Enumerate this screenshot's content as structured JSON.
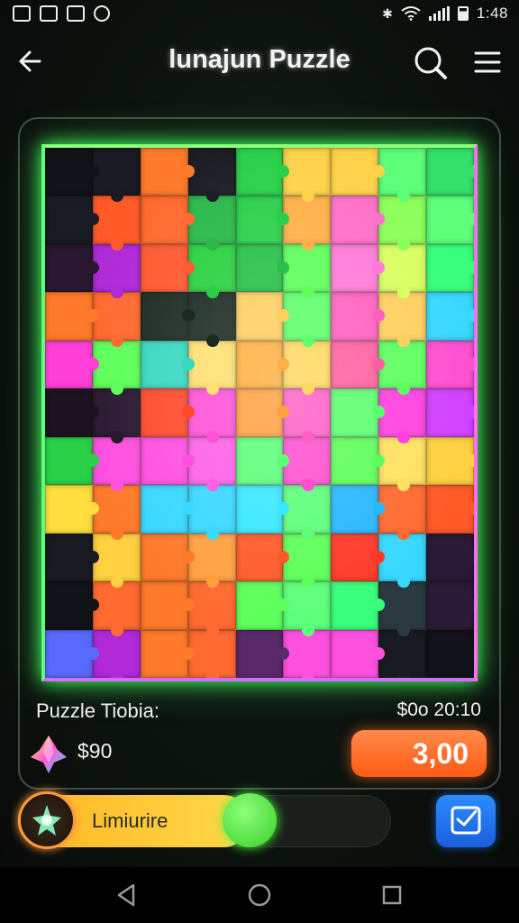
{
  "status_bar": {
    "time": "1:48",
    "left_icons": [
      "image-icon",
      "photo-icon",
      "gallery-icon",
      "shield-icon"
    ],
    "right_icons": [
      "bluetooth-icon",
      "wifi-icon",
      "signal-icon",
      "battery-icon"
    ]
  },
  "header": {
    "title": "lunajun Puzzle",
    "back_icon": "arrow-left-icon",
    "search_icon": "search-icon",
    "menu_icon": "hamburger-menu-icon"
  },
  "puzzle": {
    "grid_columns": 9,
    "grid_rows": 11,
    "frame_colors": [
      "#5dff7a",
      "#ff6cf0",
      "#d46cff"
    ],
    "colors": [
      "#111318",
      "#1a1a22",
      "#ff7a2a",
      "#1d1d26",
      "#2ad04a",
      "#ffd24a",
      "#ffd24a",
      "#5dff7a",
      "#35e06a",
      "#1b1b24",
      "#ff5a28",
      "#ff6a30",
      "#2ab84a",
      "#2ad04a",
      "#ffb048",
      "#ff70c8",
      "#8cff5a",
      "#5dff7a",
      "#2a1830",
      "#b02ad8",
      "#ff5a30",
      "#2ad040",
      "#28c048",
      "#5dff5a",
      "#ff7ad8",
      "#d8ff60",
      "#38ff7a",
      "#ff7a2a",
      "#ff6a30",
      "#1b2a20",
      "#1a2a22",
      "#ffd060",
      "#5dff6a",
      "#ff60c0",
      "#ffd060",
      "#38d8ff",
      "#ff40d8",
      "#5dff5a",
      "#38d8c0",
      "#ffe070",
      "#ffb040",
      "#ffd860",
      "#ff60a0",
      "#5dff60",
      "#ff50d0",
      "#1b1420",
      "#2a1830",
      "#ff4a2a",
      "#ff50d8",
      "#ffa040",
      "#ff60c8",
      "#5dff70",
      "#ff40e0",
      "#d040ff",
      "#2ad048",
      "#ff50e0",
      "#ff50e0",
      "#ff60e8",
      "#5dff7a",
      "#ff50d0",
      "#5dff5a",
      "#ffe060",
      "#ffd040",
      "#ffe040",
      "#ff7a2a",
      "#38d8ff",
      "#38d8ff",
      "#38e8ff",
      "#5dff7a",
      "#28b8ff",
      "#ff6a30",
      "#ff5a28",
      "#1a1a22",
      "#ffd040",
      "#ff7a2a",
      "#ffa040",
      "#ff5a28",
      "#5dff5a",
      "#ff3a2a",
      "#38d8ff",
      "#2a1a36",
      "#111318",
      "#ff6a30",
      "#ff7a2a",
      "#ff6a30",
      "#5dff5a",
      "#5dff7a",
      "#38ff7a",
      "#2a3a40",
      "#2a1a36",
      "#5a6aff",
      "#b02ad8",
      "#ff7a2a",
      "#ff6a30",
      "#5a2a6a",
      "#ff50e0",
      "#ff50e0",
      "#1a1a22",
      "#111318"
    ]
  },
  "info": {
    "puzzle_label": "Puzzle Tiobia:",
    "time_label": "$0o 20:10",
    "gem_icon": "gem-icon",
    "score": "$90",
    "price_button": "3,00"
  },
  "progress": {
    "label": "Limiurire",
    "value_fraction": 0.62,
    "badge_icon": "star-icon"
  },
  "share_button_icon": "check-message-icon",
  "nav_bar": {
    "icons": [
      "back-triangle-icon",
      "home-circle-icon",
      "recents-square-icon"
    ]
  }
}
